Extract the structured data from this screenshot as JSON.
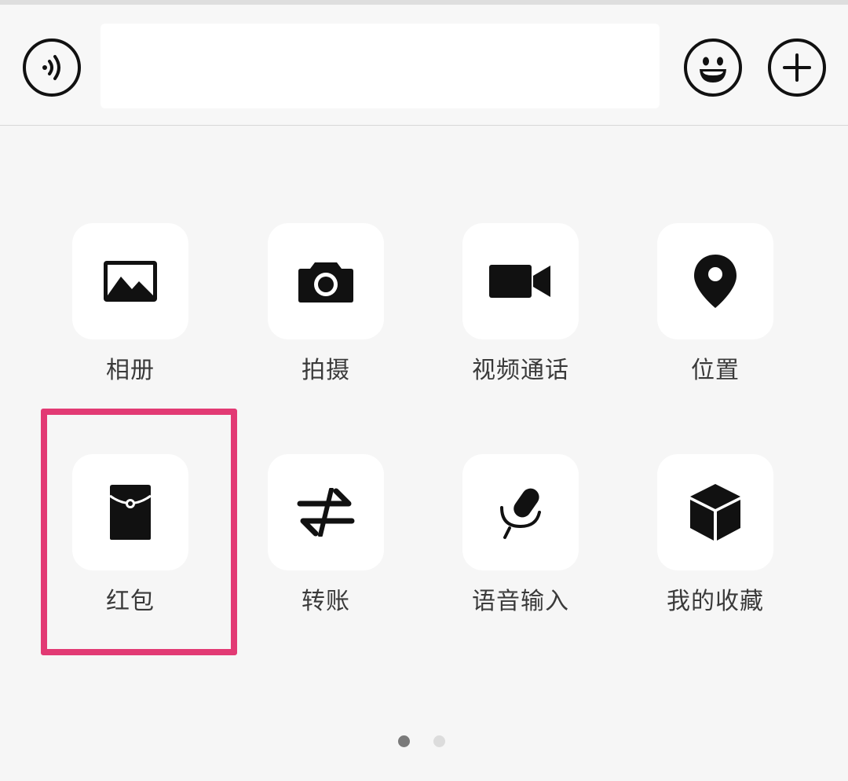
{
  "input_bar": {
    "voice_icon": "voice-icon",
    "text_value": "",
    "emoji_icon": "emoji-icon",
    "plus_icon": "plus-icon"
  },
  "panel": {
    "row1": [
      {
        "label": "相册",
        "icon": "photo-album-icon"
      },
      {
        "label": "拍摄",
        "icon": "camera-icon"
      },
      {
        "label": "视频通话",
        "icon": "video-call-icon"
      },
      {
        "label": "位置",
        "icon": "location-pin-icon"
      }
    ],
    "row2": [
      {
        "label": "红包",
        "icon": "red-packet-icon"
      },
      {
        "label": "转账",
        "icon": "transfer-arrows-icon"
      },
      {
        "label": "语音输入",
        "icon": "microphone-icon"
      },
      {
        "label": "我的收藏",
        "icon": "favorites-cube-icon"
      }
    ]
  },
  "pager": {
    "total_pages": 2,
    "current_page": 1
  },
  "colors": {
    "highlight_border": "#e23a74",
    "icon": "#111111",
    "background": "#f6f6f6"
  }
}
